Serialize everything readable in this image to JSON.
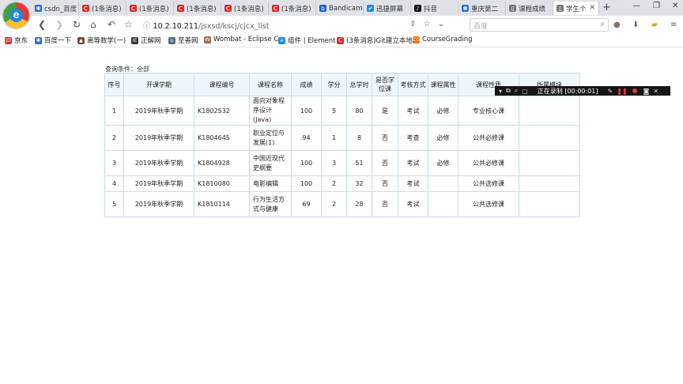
{
  "browser": {
    "tabs": [
      {
        "label": "csdn_百度",
        "icon": "paw-icon",
        "color": "#2e6bd8",
        "glyph": "✽"
      },
      {
        "label": "(1条消息)",
        "icon": "csdn-icon",
        "color": "#d32f2f",
        "glyph": "C"
      },
      {
        "label": "(1条消息)",
        "icon": "csdn-icon",
        "color": "#d32f2f",
        "glyph": "C"
      },
      {
        "label": "(1条消息)",
        "icon": "csdn-icon",
        "color": "#d32f2f",
        "glyph": "C"
      },
      {
        "label": "(1条消息)",
        "icon": "csdn-icon",
        "color": "#d32f2f",
        "glyph": "C"
      },
      {
        "label": "(1条消息)",
        "icon": "csdn-icon",
        "color": "#d32f2f",
        "glyph": "C"
      },
      {
        "label": "Bandicam",
        "icon": "bandicam-icon",
        "color": "#1565c0",
        "glyph": "b"
      },
      {
        "label": "迅捷屏幕",
        "icon": "xunjie-icon",
        "color": "#1e88e5",
        "glyph": "✔"
      },
      {
        "label": "抖音",
        "icon": "douyin-icon",
        "color": "#111111",
        "glyph": "♪"
      },
      {
        "label": "重庆第二",
        "icon": "paw-icon",
        "color": "#2e6bd8",
        "glyph": "✽"
      },
      {
        "label": "课程成绩",
        "icon": "page-icon",
        "color": "#777777",
        "glyph": "▯"
      },
      {
        "label": "学生个",
        "icon": "page-icon",
        "color": "#777777",
        "glyph": "▯"
      }
    ],
    "new_tab": "+",
    "window_controls": [
      "—",
      "❐",
      "✕"
    ],
    "url_host": "10.2.10.211",
    "url_path": "/jsxsd/kscj/cjcx_list",
    "search_placeholder": "百度",
    "bookmarks": [
      {
        "label": "京东",
        "icon": "jd-icon",
        "color": "#d32f2f",
        "glyph": "JD"
      },
      {
        "label": "百度一下",
        "icon": "paw-icon",
        "color": "#2e6bd8",
        "glyph": "✽"
      },
      {
        "label": "离等数学(一)",
        "icon": "hat-icon",
        "color": "#6d4c41",
        "glyph": "▲"
      },
      {
        "label": "正解网",
        "icon": "zj-icon",
        "color": "#333333",
        "glyph": "IE"
      },
      {
        "label": "至善网",
        "icon": "zs-icon",
        "color": "#546e7a",
        "glyph": "⌂"
      },
      {
        "label": "Wombat - Eclipse C",
        "icon": "wombat-icon",
        "color": "#8d6e63",
        "glyph": "W"
      },
      {
        "label": "组件 | Element",
        "icon": "element-icon",
        "color": "#1e88e5",
        "glyph": "e"
      },
      {
        "label": "(3条消息)Git建立本地",
        "icon": "csdn-icon",
        "color": "#d32f2f",
        "glyph": "C"
      },
      {
        "label": "CourseGrading",
        "icon": "cg-icon",
        "color": "#ef6c00",
        "glyph": "CG"
      }
    ]
  },
  "page": {
    "query_condition": "查询条件：全部",
    "columns": [
      "序号",
      "开课学期",
      "课程编号",
      "课程名称",
      "成绩",
      "学分",
      "总学时",
      "是否学位课",
      "考核方式",
      "课程属性",
      "课程性质",
      "所属模块"
    ],
    "rows": [
      [
        "1",
        "2019年秋季学期",
        "K1802532",
        "面向对象程序设计(Java)",
        "100",
        "5",
        "80",
        "是",
        "考试",
        "必修",
        "专业核心课",
        ""
      ],
      [
        "2",
        "2019年秋季学期",
        "K1804645",
        "职业定位与发展(1)",
        "94",
        "1",
        "8",
        "否",
        "考查",
        "必修",
        "公共必修课",
        ""
      ],
      [
        "3",
        "2019年秋季学期",
        "K1804928",
        "中国近现代史纲要",
        "100",
        "3",
        "51",
        "否",
        "考试",
        "必修",
        "公共必修课",
        ""
      ],
      [
        "4",
        "2019年秋季学期",
        "K1810080",
        "电影编辑",
        "100",
        "2",
        "32",
        "否",
        "考试",
        "",
        "公共选修课",
        ""
      ],
      [
        "5",
        "2019年秋季学期",
        "K1810114",
        "行为生活方式与健康",
        "69",
        "2",
        "28",
        "否",
        "考试",
        "",
        "公共选修课",
        ""
      ]
    ]
  },
  "recorder": {
    "status": "正在录制 [00:00:01]"
  }
}
